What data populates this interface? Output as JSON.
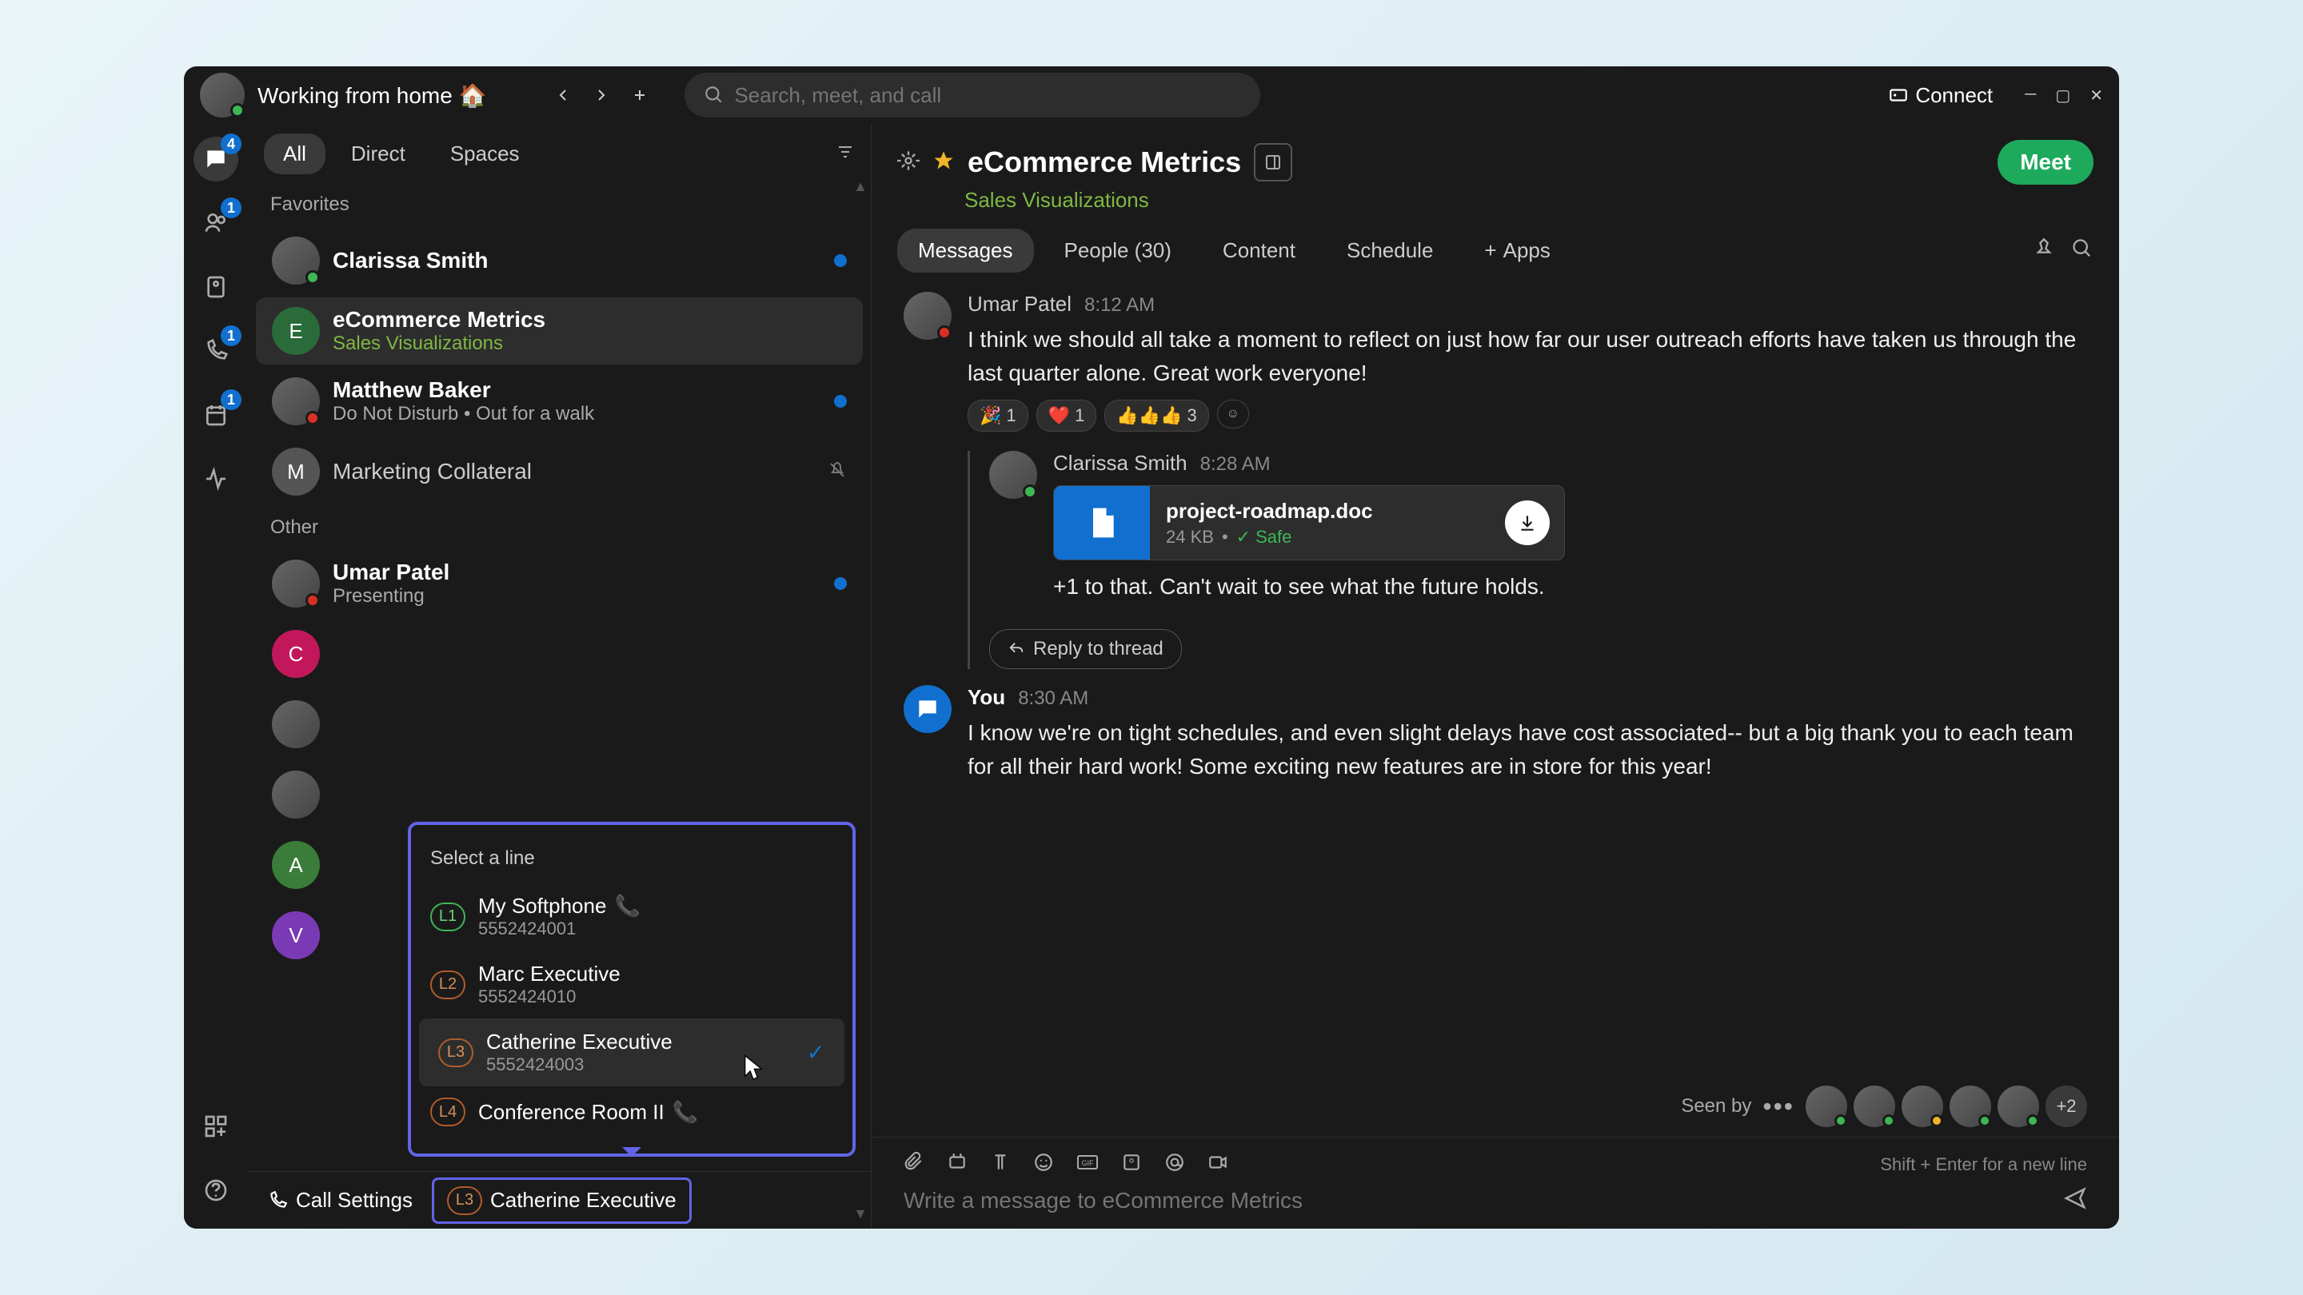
{
  "titlebar": {
    "status": "Working from home 🏠",
    "search_placeholder": "Search, meet, and call",
    "connect": "Connect"
  },
  "rail": {
    "chat_badge": "4",
    "teams_badge": "1",
    "call_badge": "1",
    "calendar_badge": "1"
  },
  "sidebar": {
    "tabs": {
      "all": "All",
      "direct": "Direct",
      "spaces": "Spaces"
    },
    "sections": {
      "favorites": "Favorites",
      "other": "Other"
    },
    "items": [
      {
        "name": "Clarissa Smith",
        "sub": "",
        "avatar": "img",
        "status": "green",
        "unread": true
      },
      {
        "name": "eCommerce Metrics",
        "sub": "Sales Visualizations",
        "avatar": "E",
        "color": "#2a6b3a",
        "unread": false,
        "selected": true,
        "sub_green": true
      },
      {
        "name": "Matthew Baker",
        "sub": "Do Not Disturb  •  Out for a walk",
        "avatar": "img",
        "status": "red",
        "unread": true
      },
      {
        "name": "Marketing Collateral",
        "sub": "",
        "avatar": "M",
        "color": "#555",
        "muted": true
      }
    ],
    "other_items": [
      {
        "name": "Umar Patel",
        "sub": "Presenting",
        "avatar": "img",
        "status": "red",
        "unread": true
      },
      {
        "name": "",
        "avatar": "C",
        "color": "#c2185b"
      },
      {
        "name": "",
        "avatar": "img"
      },
      {
        "name": "",
        "avatar": "img"
      },
      {
        "name": "",
        "avatar": "A",
        "color": "#3a7c3a"
      },
      {
        "name": "",
        "avatar": "V",
        "color": "#7b3ab5"
      }
    ]
  },
  "line_popup": {
    "header": "Select a line",
    "lines": [
      {
        "badge": "L1",
        "name": "My Softphone",
        "number": "5552424001",
        "handset": true,
        "badge_color": "green"
      },
      {
        "badge": "L2",
        "name": "Marc Executive",
        "number": "5552424010",
        "badge_color": "orange"
      },
      {
        "badge": "L3",
        "name": "Catherine Executive",
        "number": "5552424003",
        "badge_color": "orange",
        "selected": true
      },
      {
        "badge": "L4",
        "name": "Conference Room II",
        "number": "",
        "handset": true,
        "badge_color": "orange"
      }
    ]
  },
  "bottom_bar": {
    "call_settings": "Call Settings",
    "line_badge": "L3",
    "line_name": "Catherine Executive"
  },
  "chat": {
    "title": "eCommerce Metrics",
    "subtitle": "Sales Visualizations",
    "meet": "Meet",
    "tabs": {
      "messages": "Messages",
      "people": "People (30)",
      "content": "Content",
      "schedule": "Schedule",
      "apps": "Apps"
    },
    "messages": [
      {
        "author": "Umar Patel",
        "time": "8:12 AM",
        "text": "I think we should all take a moment to reflect on just how far our user outreach efforts have taken us through the last quarter alone. Great work everyone!",
        "reactions": [
          {
            "emoji": "🎉",
            "count": "1"
          },
          {
            "emoji": "❤️",
            "count": "1"
          },
          {
            "emoji": "👍👍👍",
            "count": "3"
          }
        ]
      },
      {
        "author": "Clarissa Smith",
        "time": "8:28 AM",
        "attachment": {
          "name": "project-roadmap.doc",
          "size": "24 KB",
          "safe": "Safe"
        },
        "text": "+1 to that. Can't wait to see what the future holds.",
        "reply_btn": "Reply to thread"
      },
      {
        "author": "You",
        "time": "8:30 AM",
        "text": "I know we're on tight schedules, and even slight delays have cost associated-- but a big thank you to each team for all their hard work! Some exciting new features are in store for this year!"
      }
    ],
    "seen_by": {
      "label": "Seen by",
      "more": "+2"
    },
    "composer": {
      "placeholder": "Write a message to eCommerce Metrics",
      "hint": "Shift + Enter for a new line"
    }
  }
}
